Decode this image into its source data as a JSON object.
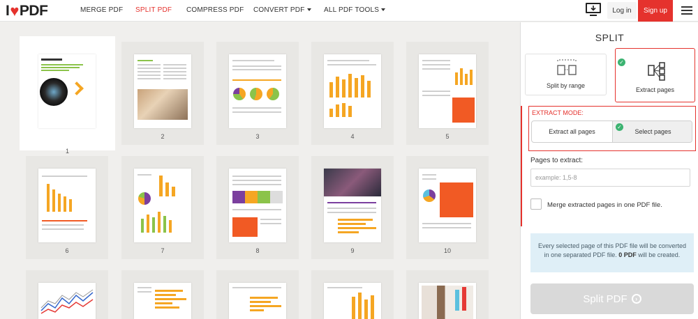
{
  "header": {
    "logo_left": "I",
    "logo_right": "PDF",
    "nav": [
      {
        "label": "MERGE PDF",
        "active": false,
        "dropdown": false
      },
      {
        "label": "SPLIT PDF",
        "active": true,
        "dropdown": false
      },
      {
        "label": "COMPRESS PDF",
        "active": false,
        "dropdown": false
      },
      {
        "label": "CONVERT PDF",
        "active": false,
        "dropdown": true
      },
      {
        "label": "ALL PDF TOOLS",
        "active": false,
        "dropdown": true
      }
    ],
    "login_label": "Log in",
    "signup_label": "Sign up",
    "accent_color": "#e5322d"
  },
  "pages": {
    "numbers": [
      "1",
      "2",
      "3",
      "4",
      "5",
      "6",
      "7",
      "8",
      "9",
      "10"
    ],
    "selected_page": "1"
  },
  "sidebar": {
    "title": "SPLIT",
    "modes": [
      {
        "label": "Split by range",
        "icon": "split-range-icon",
        "selected": false
      },
      {
        "label": "Extract pages",
        "icon": "extract-pages-icon",
        "selected": true
      }
    ],
    "extract_mode_label": "EXTRACT MODE:",
    "extract_options": [
      {
        "label": "Extract all pages",
        "selected": false
      },
      {
        "label": "Select pages",
        "selected": true
      }
    ],
    "pages_to_extract_label": "Pages to extract:",
    "pages_to_extract_value": "",
    "pages_to_extract_placeholder": "example: 1,5-8",
    "merge_label": "Merge extracted pages in one PDF file.",
    "merge_checked": false,
    "info_text_1": "Every selected page of this PDF file will be converted in one separated PDF file.",
    "info_bold": "0 PDF",
    "info_text_2": "will be created.",
    "split_button_label": "Split PDF"
  }
}
